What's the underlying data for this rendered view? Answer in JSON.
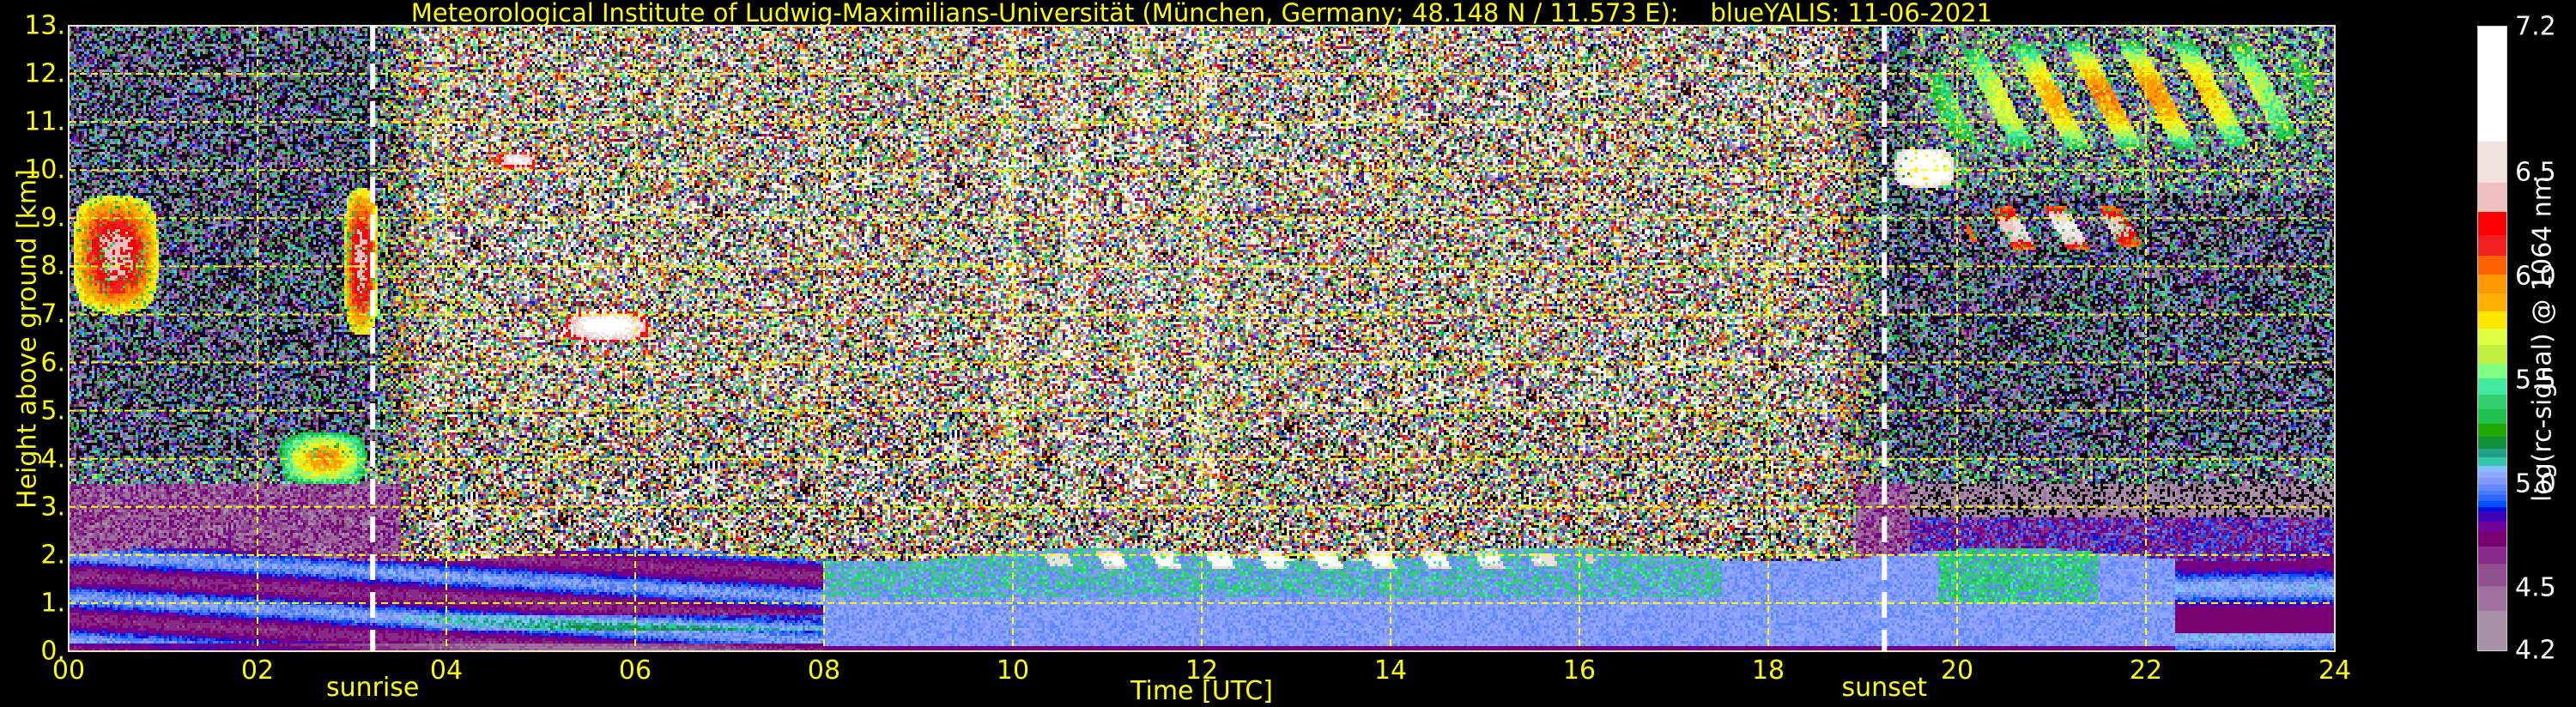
{
  "chart_data": {
    "type": "heatmap",
    "title": "Meteorological Institute of Ludwig-Maximilians-Universität (München, Germany; 48.148 N / 11.573 E):    blueYALIS: 11-06-2021",
    "xlabel": "Time [UTC]",
    "ylabel": "Height above ground [km]",
    "xlim": [
      0,
      24
    ],
    "ylim": [
      0,
      13
    ],
    "x_ticks": [
      0,
      2,
      4,
      6,
      8,
      10,
      12,
      14,
      16,
      18,
      20,
      22,
      24
    ],
    "x_tick_labels": [
      "00",
      "02",
      "04",
      "06",
      "08",
      "10",
      "12",
      "14",
      "16",
      "18",
      "20",
      "22",
      "24"
    ],
    "y_ticks": [
      0,
      1,
      2,
      3,
      4,
      5,
      6,
      7,
      8,
      9,
      10,
      11,
      12,
      13
    ],
    "y_tick_labels": [
      "0.",
      "1.",
      "2.",
      "3.",
      "4.",
      "5.",
      "6.",
      "7.",
      "8.",
      "9.",
      "10.",
      "11.",
      "12.",
      "13."
    ],
    "grid": true,
    "grid_color": "#ffff00",
    "annotations": [
      {
        "label": "sunrise",
        "time": 3.22
      },
      {
        "label": "sunset",
        "time": 19.23
      }
    ],
    "colorbar": {
      "label": "log(rc-signal) @ 1064 nm",
      "range": [
        4.2,
        7.2
      ],
      "tick_values": [
        4.2,
        4.5,
        5.0,
        5.5,
        6.0,
        6.5,
        7.2
      ],
      "tick_labels": [
        "4.2",
        "4.5",
        "5.0",
        "5.5",
        "6.0",
        "6.5",
        "7.2"
      ],
      "levels": [
        {
          "from": 4.2,
          "color": "#a890a8"
        },
        {
          "from": 4.39,
          "color": "#a070a0"
        },
        {
          "from": 4.51,
          "color": "#905090"
        },
        {
          "from": 4.62,
          "color": "#882888"
        },
        {
          "from": 4.7,
          "color": "#780070"
        },
        {
          "from": 4.77,
          "color": "#700098"
        },
        {
          "from": 4.82,
          "color": "#4000b8"
        },
        {
          "from": 4.87,
          "color": "#0010e0"
        },
        {
          "from": 4.89,
          "color": "#0050ff"
        },
        {
          "from": 4.92,
          "color": "#3068ff"
        },
        {
          "from": 4.95,
          "color": "#4878ff"
        },
        {
          "from": 4.97,
          "color": "#6088ff"
        },
        {
          "from": 5.0,
          "color": "#8098ff"
        },
        {
          "from": 5.03,
          "color": "#90a8ff"
        },
        {
          "from": 5.06,
          "color": "#80c0ff"
        },
        {
          "from": 5.09,
          "color": "#30c8a8"
        },
        {
          "from": 5.13,
          "color": "#20a088"
        },
        {
          "from": 5.17,
          "color": "#109038"
        },
        {
          "from": 5.23,
          "color": "#20a800"
        },
        {
          "from": 5.29,
          "color": "#20c050"
        },
        {
          "from": 5.36,
          "color": "#30d070"
        },
        {
          "from": 5.43,
          "color": "#40e8a0"
        },
        {
          "from": 5.51,
          "color": "#80ff80"
        },
        {
          "from": 5.58,
          "color": "#c0f040"
        },
        {
          "from": 5.67,
          "color": "#e0ff40"
        },
        {
          "from": 5.75,
          "color": "#ffe800"
        },
        {
          "from": 5.83,
          "color": "#ffb000"
        },
        {
          "from": 5.92,
          "color": "#ff9800"
        },
        {
          "from": 6.01,
          "color": "#ff6000"
        },
        {
          "from": 6.1,
          "color": "#f02020"
        },
        {
          "from": 6.2,
          "color": "#ff0000"
        },
        {
          "from": 6.31,
          "color": "#f0c0c0"
        },
        {
          "from": 6.45,
          "color": "#f0e0e0"
        },
        {
          "from": 6.65,
          "color": "#ffffff"
        }
      ]
    },
    "cloud_layers": [
      {
        "t": [
          0.0,
          1.0
        ],
        "h": [
          6.9,
          9.6
        ],
        "signal": 6.1
      },
      {
        "t": [
          2.9,
          3.3
        ],
        "h": [
          6.4,
          9.8
        ],
        "signal": 6.1
      },
      {
        "t": [
          2.2,
          3.2
        ],
        "h": [
          3.4,
          4.6
        ],
        "signal": 5.7
      },
      {
        "t": [
          5.2,
          6.2
        ],
        "h": [
          6.4,
          7.1
        ],
        "signal": 6.6
      },
      {
        "t": [
          4.5,
          5.0
        ],
        "h": [
          10.0,
          10.4
        ],
        "signal": 6.4
      },
      {
        "t": [
          19.3,
          20.0
        ],
        "h": [
          9.6,
          10.5
        ],
        "signal": 6.9
      },
      {
        "t": [
          20.0,
          22.2
        ],
        "h": [
          8.3,
          9.3
        ],
        "signal": 6.4
      },
      {
        "t": [
          19.5,
          24.0
        ],
        "h": [
          10.3,
          12.8
        ],
        "signal": 5.7
      },
      {
        "t": [
          9.7,
          16.5
        ],
        "h": [
          1.7,
          2.1
        ],
        "signal": 6.8
      }
    ]
  }
}
